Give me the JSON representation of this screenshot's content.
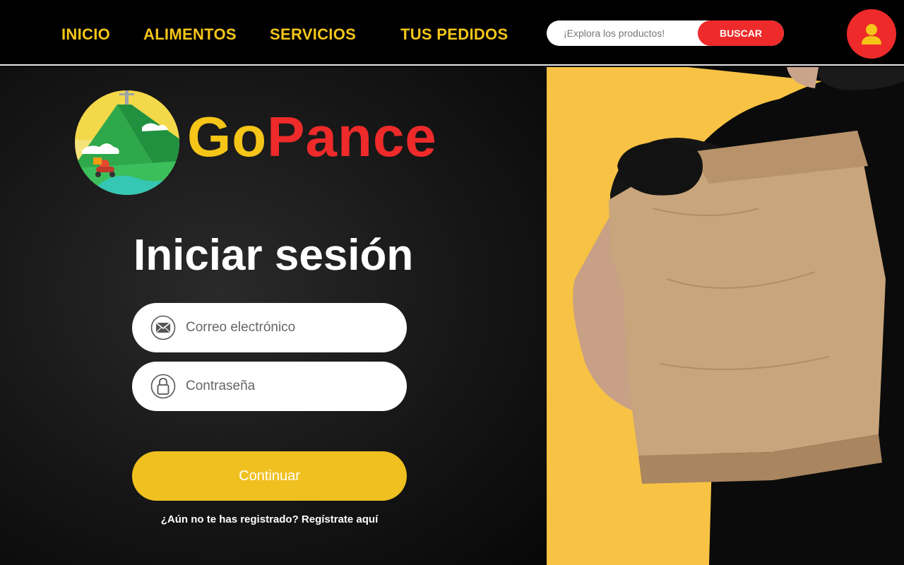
{
  "nav": {
    "items": [
      {
        "label": "INICIO"
      },
      {
        "label": "ALIMENTOS"
      },
      {
        "label": "SERVICIOS"
      },
      {
        "label": "TUS PEDIDOS"
      }
    ]
  },
  "search": {
    "placeholder": "¡Explora los productos!",
    "button_label": "BUSCAR"
  },
  "account": {
    "icon": "user-icon"
  },
  "brand": {
    "part1": "Go",
    "part2": "Pance"
  },
  "login": {
    "title": "Iniciar sesión",
    "email_placeholder": "Correo electrónico",
    "email_icon": "envelope-icon",
    "password_placeholder": "Contraseña",
    "password_icon": "lock-icon",
    "submit_label": "Continuar",
    "register_link": "¿Aún no te has registrado? Regístrate aquí"
  },
  "colors": {
    "accent_yellow": "#f5c518",
    "accent_red": "#ee2a2a",
    "background": "#000000",
    "hero_yellow": "#f8c244"
  }
}
